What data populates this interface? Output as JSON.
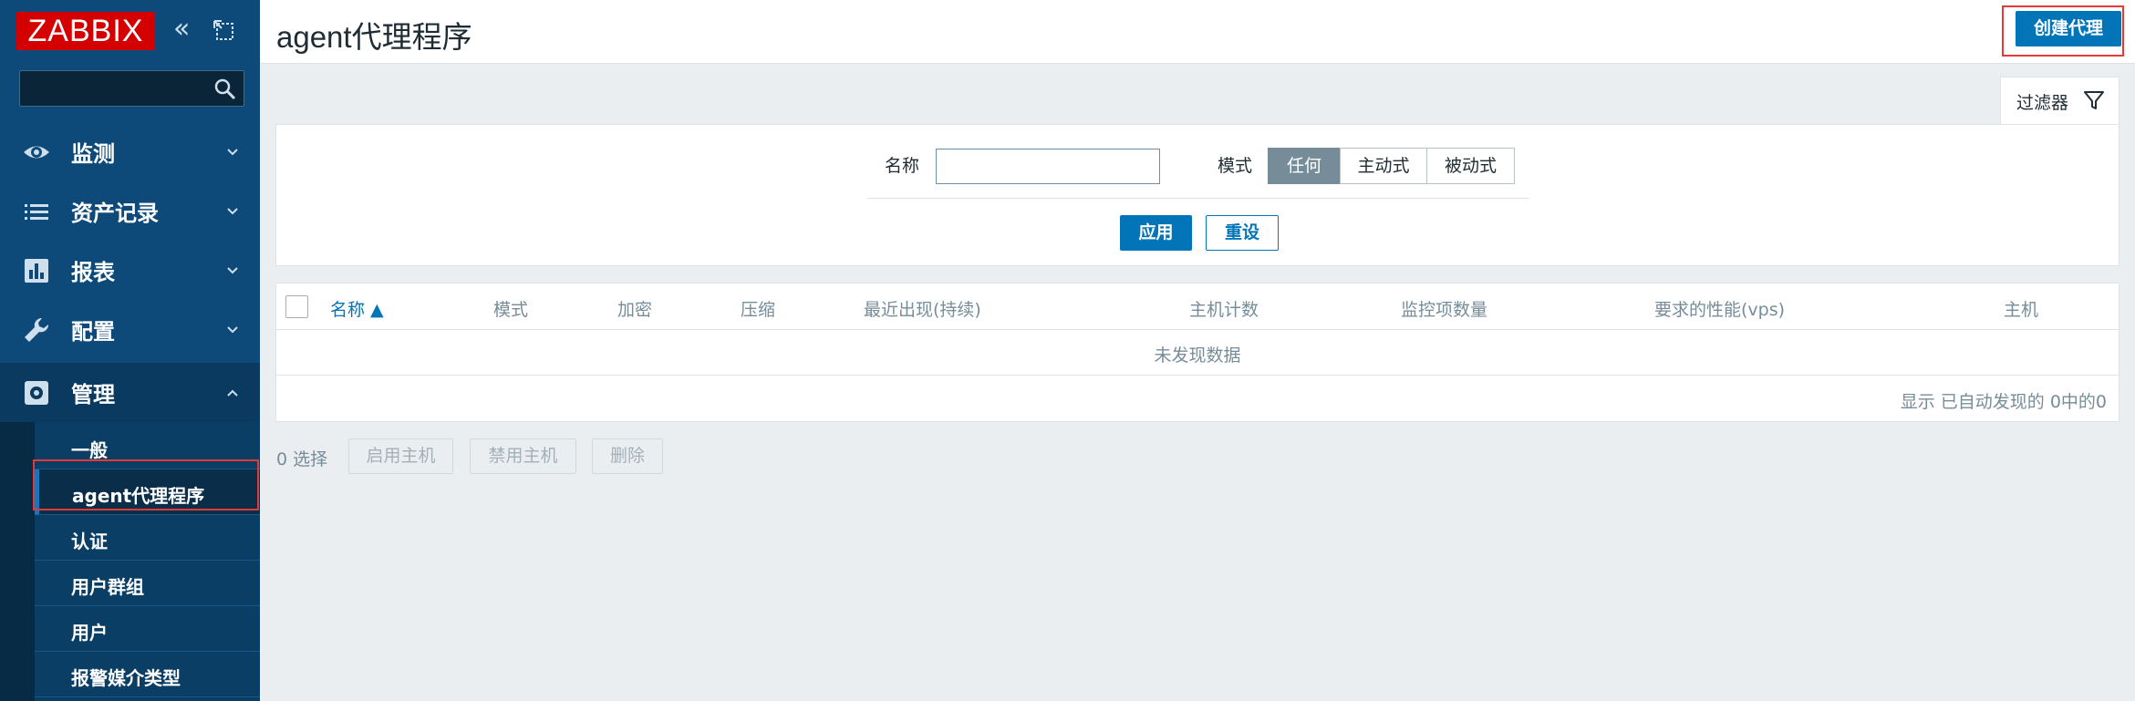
{
  "app": {
    "logo_text": "ZABBIX",
    "accent": "#d40000"
  },
  "sidebar": {
    "search_placeholder": "",
    "menu": [
      {
        "label": "监测",
        "icon": "eye-icon"
      },
      {
        "label": "资产记录",
        "icon": "list-icon"
      },
      {
        "label": "报表",
        "icon": "bar-chart-icon"
      },
      {
        "label": "配置",
        "icon": "wrench-icon"
      },
      {
        "label": "管理",
        "icon": "gear-icon"
      }
    ],
    "submenu": [
      {
        "label": "一般"
      },
      {
        "label": "agent代理程序"
      },
      {
        "label": "认证"
      },
      {
        "label": "用户群组"
      },
      {
        "label": "用户"
      },
      {
        "label": "报警媒介类型"
      }
    ]
  },
  "header": {
    "title": "agent代理程序",
    "create_button": "创建代理"
  },
  "filter": {
    "tab_label": "过滤器",
    "name_label": "名称",
    "name_value": "",
    "mode_label": "模式",
    "mode_options": [
      "任何",
      "主动式",
      "被动式"
    ],
    "mode_selected": "任何",
    "apply": "应用",
    "reset": "重设"
  },
  "table": {
    "columns": [
      "名称 ▲",
      "模式",
      "加密",
      "压缩",
      "最近出现(持续)",
      "主机计数",
      "监控项数量",
      "要求的性能(vps)",
      "主机"
    ],
    "empty_text": "未发现数据",
    "footer": "显示 已自动发现的 0中的0"
  },
  "actions": {
    "selected": "0 选择",
    "enable_hosts": "启用主机",
    "disable_hosts": "禁用主机",
    "delete": "删除"
  }
}
